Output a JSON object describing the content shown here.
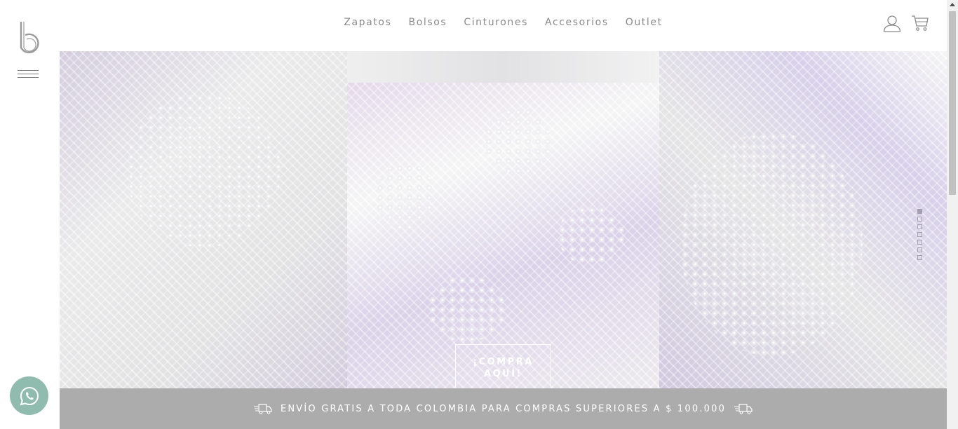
{
  "brand": {
    "logo_icon": "b-logo-icon"
  },
  "nav": {
    "links": [
      "Zapatos",
      "Bolsos",
      "Cinturones",
      "Accesorios",
      "Outlet"
    ],
    "icons": [
      "user-icon",
      "cart-icon"
    ]
  },
  "hero": {
    "cta_line1": "¡COMPRA",
    "cta_line2": "AQUÍ!",
    "slides_total": 7,
    "active_slide": 1
  },
  "shipping_bar": {
    "text": "ENVÍO GRATIS A TODA COLOMBIA PARA COMPRAS SUPERIORES A $ 100.000",
    "icon": "truck-icon"
  },
  "whatsapp": {
    "icon": "whatsapp-icon",
    "color": "#8fbcae"
  },
  "colors": {
    "ship_bar": "#acacac",
    "nav_text": "#8a8a8a"
  }
}
